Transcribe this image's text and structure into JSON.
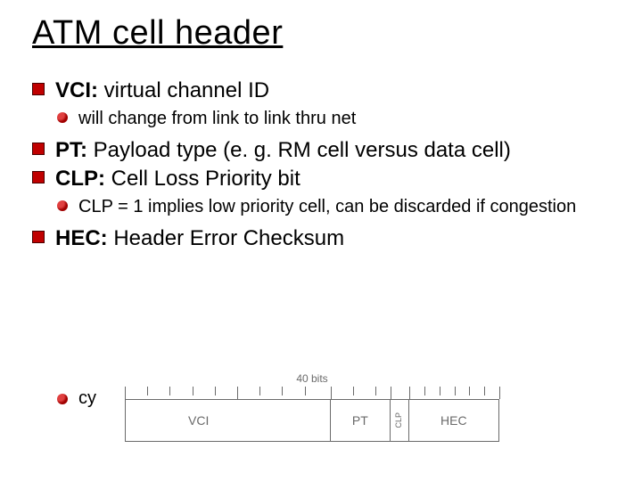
{
  "title": "ATM cell header",
  "bullets": {
    "vci_label": "VCI:",
    "vci_text": " virtual channel ID",
    "vci_sub": "will change from link to link thru net",
    "pt_label": "PT:",
    "pt_text": " Payload type (e. g. RM cell versus data cell)",
    "clp_label": "CLP:",
    "clp_text": " Cell Loss Priority bit",
    "clp_sub": "CLP = 1 implies low priority cell, can be discarded if congestion",
    "hec_label": "HEC:",
    "hec_text": " Header Error Checksum",
    "hec_sub_fragment": "cy"
  },
  "figure": {
    "caption": "40 bits",
    "fields": {
      "vci": "VCI",
      "pt": "PT",
      "clp": "CLP",
      "hec": "HEC"
    }
  }
}
